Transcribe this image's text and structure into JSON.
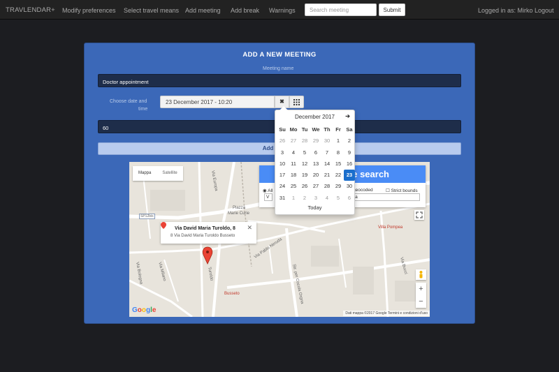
{
  "navbar": {
    "brand": "TRAVLENDAR+",
    "items": [
      "Modify preferences",
      "Select travel means",
      "Add meeting",
      "Add break",
      "Warnings"
    ],
    "search_placeholder": "Search meeting",
    "submit_label": "Submit",
    "logged_in": "Logged in as: Mirko",
    "logout": "Logout"
  },
  "form": {
    "title": "ADD A NEW MEETING",
    "name_label": "Meeting name",
    "name_value": "Doctor appointment",
    "date_label_line1": "Choose date and",
    "date_label_line2": "time",
    "date_value": "23 December 2017 - 10:20",
    "duration_value": "60",
    "add_button": "Add meeting"
  },
  "datepicker": {
    "month": "December 2017",
    "next": "➔",
    "weekdays": [
      "Su",
      "Mo",
      "Tu",
      "We",
      "Th",
      "Fr",
      "Sa"
    ],
    "weeks": [
      [
        "26",
        "27",
        "28",
        "29",
        "30",
        "1",
        "2"
      ],
      [
        "3",
        "4",
        "5",
        "6",
        "7",
        "8",
        "9"
      ],
      [
        "10",
        "11",
        "12",
        "13",
        "14",
        "15",
        "16"
      ],
      [
        "17",
        "18",
        "19",
        "20",
        "21",
        "22",
        "23"
      ],
      [
        "24",
        "25",
        "26",
        "27",
        "28",
        "29",
        "30"
      ],
      [
        "31",
        "1",
        "2",
        "3",
        "4",
        "5",
        "6"
      ]
    ],
    "selected": "23",
    "today_label": "Today"
  },
  "map": {
    "type_map": "Mappa",
    "type_satellite": "Satellite",
    "search_title": "e search",
    "radio_all": "All",
    "radio_geocoded": "geocoded",
    "radio_strict": "Strict bounds",
    "search_value": "Italia",
    "search_value_left": "V",
    "info_title": "Via David Maria Turoldo, 8",
    "info_sub": "8 Via David Maria Turoldo Busseto",
    "info_close": "✕",
    "streets": {
      "europa": "Via Europa",
      "piazza1": "Piazza",
      "piazza2": "Marie Curie",
      "sp": "SP12bis",
      "villa": "Villa Pompea",
      "nevuda": "Via Pablo Neruda",
      "bologna": "Via Bologna",
      "milano": "Via Milano",
      "turoldo": "Turoldo",
      "roncole": "Str. per Cocola Orgna",
      "busseto": "Busseto",
      "bucci": "Via Bucci"
    },
    "footer": "Dati mappa ©2017 Google    Termini e condizioni d'uso",
    "google_letters": [
      "G",
      "o",
      "o",
      "g",
      "l",
      "e"
    ],
    "google_colors": [
      "#4285f4",
      "#ea4335",
      "#fbbc05",
      "#4285f4",
      "#34a853",
      "#ea4335"
    ]
  },
  "colors": {
    "panel": "#3b68b8",
    "accent": "#1a6ecc",
    "navbar": "#222222"
  }
}
